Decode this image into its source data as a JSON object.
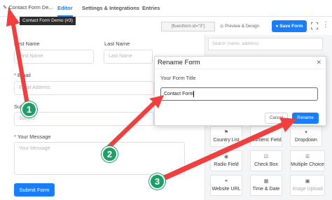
{
  "header": {
    "form_title": "Contact Form De...",
    "tooltip": "Contact Form Demo (#3)",
    "tabs": [
      {
        "label": "Editor",
        "active": true
      },
      {
        "label": "Settings & Integrations",
        "active": false
      },
      {
        "label": "Entries",
        "active": false
      }
    ],
    "shortcode": "[fluentform id=\"3\"]",
    "preview_label": "Preview & Design",
    "save_label": "Save Form"
  },
  "form": {
    "first_name_label": "First Name",
    "first_name_placeholder": "First Name",
    "last_name_label": "Last Name",
    "last_name_placeholder": "Last Name",
    "email_label": "Email",
    "email_placeholder": "Email Address",
    "subject_label": "Subject",
    "subject_placeholder": "Subject",
    "message_label": "Your Message",
    "message_placeholder": "Your Message",
    "required_mark": "*",
    "submit_label": "Submit Form"
  },
  "sidebar": {
    "search_placeholder": "Search (name, address)",
    "fields": [
      {
        "label": "Country List",
        "icon": "flag-icon"
      },
      {
        "label": "Numeric Field",
        "icon": "hash-icon"
      },
      {
        "label": "Dropdown",
        "icon": "dropdown-icon"
      },
      {
        "label": "Radio Field",
        "icon": "radio-icon"
      },
      {
        "label": "Check Box",
        "icon": "checkbox-icon"
      },
      {
        "label": "Multiple Choice",
        "icon": "list-icon"
      },
      {
        "label": "Website URL",
        "icon": "link-icon"
      },
      {
        "label": "Time & Date",
        "icon": "calendar-icon"
      },
      {
        "label": "Image Upload",
        "icon": "image-icon"
      }
    ]
  },
  "modal": {
    "title": "Rename Form",
    "field_label": "Your Form Title",
    "field_value": "Contact Form",
    "cancel_label": "Cancel",
    "rename_label": "Rename"
  },
  "callouts": {
    "badges": [
      "1",
      "2",
      "3"
    ],
    "arrow_color": "#ef3f3f",
    "badge_color": "#1e9f6a"
  },
  "colors": {
    "accent": "#1a7efb",
    "required": "#e33333"
  }
}
